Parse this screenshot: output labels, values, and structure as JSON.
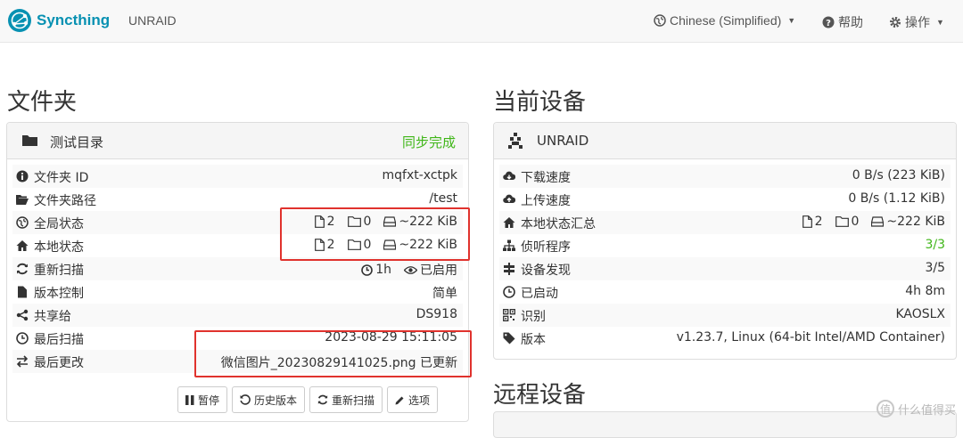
{
  "nav": {
    "brand": "Syncthing",
    "device": "UNRAID",
    "language": "Chinese (Simplified)",
    "help": "帮助",
    "actions": "操作"
  },
  "folders": {
    "title": "文件夹",
    "folder": {
      "name": "测试目录",
      "status": "同步完成",
      "rows": [
        {
          "label": "文件夹 ID",
          "value": "mqfxt-xctpk"
        },
        {
          "label": "文件夹路径",
          "value": "/test"
        },
        {
          "label": "全局状态",
          "files": "2",
          "dirs": "0",
          "size": "~222 KiB"
        },
        {
          "label": "本地状态",
          "files": "2",
          "dirs": "0",
          "size": "~222 KiB"
        },
        {
          "label": "重新扫描",
          "interval": "1h",
          "watch": "已启用"
        },
        {
          "label": "版本控制",
          "value": "简单"
        },
        {
          "label": "共享给",
          "value": "DS918"
        },
        {
          "label": "最后扫描",
          "value": "2023-08-29 15:11:05"
        },
        {
          "label": "最后更改",
          "value": "微信图片_20230829141025.png 已更新"
        }
      ],
      "buttons": {
        "pause": "暂停",
        "versions": "历史版本",
        "rescan": "重新扫描",
        "options": "选项"
      }
    }
  },
  "this_device": {
    "title": "当前设备",
    "name": "UNRAID",
    "rows": [
      {
        "label": "下载速度",
        "value": "0 B/s (223 KiB)"
      },
      {
        "label": "上传速度",
        "value": "0 B/s (1.12 KiB)"
      },
      {
        "label": "本地状态汇总",
        "files": "2",
        "dirs": "0",
        "size": "~222 KiB"
      },
      {
        "label": "侦听程序",
        "value": "3/3"
      },
      {
        "label": "设备发现",
        "value": "3/5"
      },
      {
        "label": "已启动",
        "value": "4h 8m"
      },
      {
        "label": "识别",
        "value": "KAOSLX"
      },
      {
        "label": "版本",
        "value": "v1.23.7, Linux (64-bit Intel/AMD Container)"
      }
    ]
  },
  "remote_devices": {
    "title": "远程设备"
  },
  "watermark": {
    "text": "什么值得买",
    "badge": "值"
  },
  "colors": {
    "accent": "#2a9fd6",
    "success": "#3fb618",
    "brand": "#0891b2",
    "highlight": "#e0322d"
  }
}
